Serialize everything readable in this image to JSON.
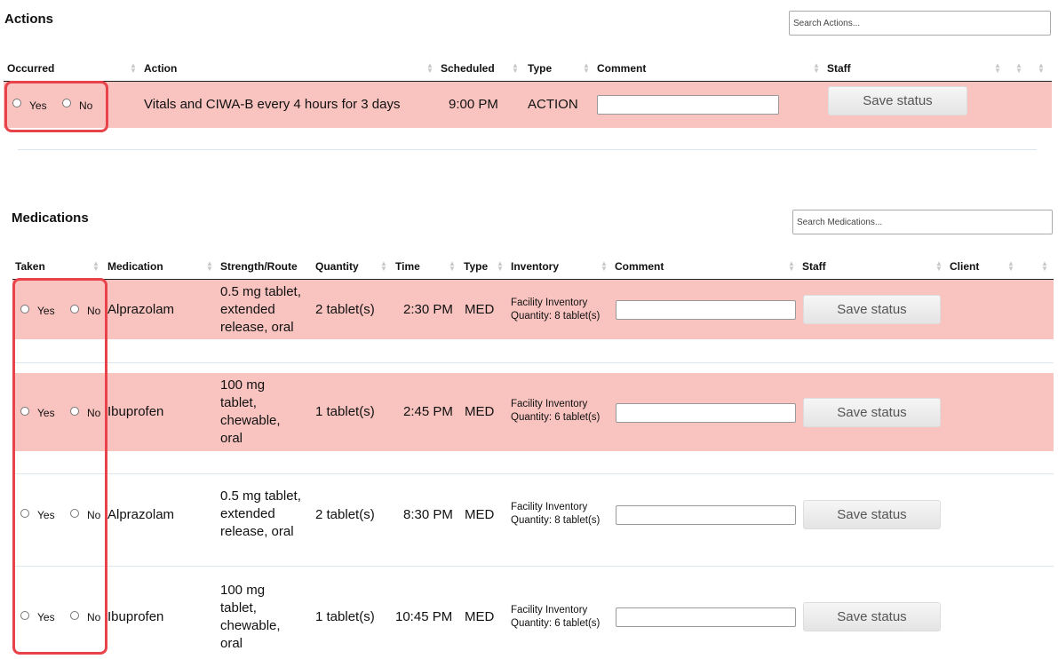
{
  "actions": {
    "title": "Actions",
    "search_placeholder": "Search Actions...",
    "columns": [
      "Occurred",
      "Action",
      "Scheduled",
      "Type",
      "Comment",
      "Staff"
    ],
    "rows": [
      {
        "yes": "Yes",
        "no": "No",
        "action": "Vitals and CIWA-B every 4 hours for 3 days",
        "scheduled": "9:00 PM",
        "type": "ACTION",
        "save": "Save status"
      }
    ]
  },
  "medications": {
    "title": "Medications",
    "search_placeholder": "Search Medications...",
    "columns": [
      "Taken",
      "Medication",
      "Strength/Route",
      "Quantity",
      "Time",
      "Type",
      "Inventory",
      "Comment",
      "Staff",
      "Client"
    ],
    "rows": [
      {
        "yes": "Yes",
        "no": "No",
        "medication": "Alprazolam",
        "strength": [
          "0.5 mg tablet,",
          "extended",
          "release, oral"
        ],
        "quantity": "2 tablet(s)",
        "time": "2:30 PM",
        "type": "MED",
        "inventory": [
          "Facility Inventory",
          "Quantity: 8 tablet(s)"
        ],
        "save": "Save status",
        "highlight": true
      },
      {
        "yes": "Yes",
        "no": "No",
        "medication": "Ibuprofen",
        "strength": [
          "100 mg",
          "tablet,",
          "chewable,",
          "oral"
        ],
        "quantity": "1 tablet(s)",
        "time": "2:45 PM",
        "type": "MED",
        "inventory": [
          "Facility Inventory",
          "Quantity: 6 tablet(s)"
        ],
        "save": "Save status",
        "highlight": true
      },
      {
        "yes": "Yes",
        "no": "No",
        "medication": "Alprazolam",
        "strength": [
          "0.5 mg tablet,",
          "extended",
          "release, oral"
        ],
        "quantity": "2 tablet(s)",
        "time": "8:30 PM",
        "type": "MED",
        "inventory": [
          "Facility Inventory",
          "Quantity: 8 tablet(s)"
        ],
        "save": "Save status",
        "highlight": false
      },
      {
        "yes": "Yes",
        "no": "No",
        "medication": "Ibuprofen",
        "strength": [
          "100 mg",
          "tablet,",
          "chewable,",
          "oral"
        ],
        "quantity": "1 tablet(s)",
        "time": "10:45 PM",
        "type": "MED",
        "inventory": [
          "Facility Inventory",
          "Quantity: 6 tablet(s)"
        ],
        "save": "Save status",
        "highlight": false
      }
    ]
  },
  "colors": {
    "row_highlight": "#f9c4c0",
    "callout_border": "#e8424a"
  },
  "icons": [
    "sort-arrows-icon",
    "radio-button-icon"
  ]
}
